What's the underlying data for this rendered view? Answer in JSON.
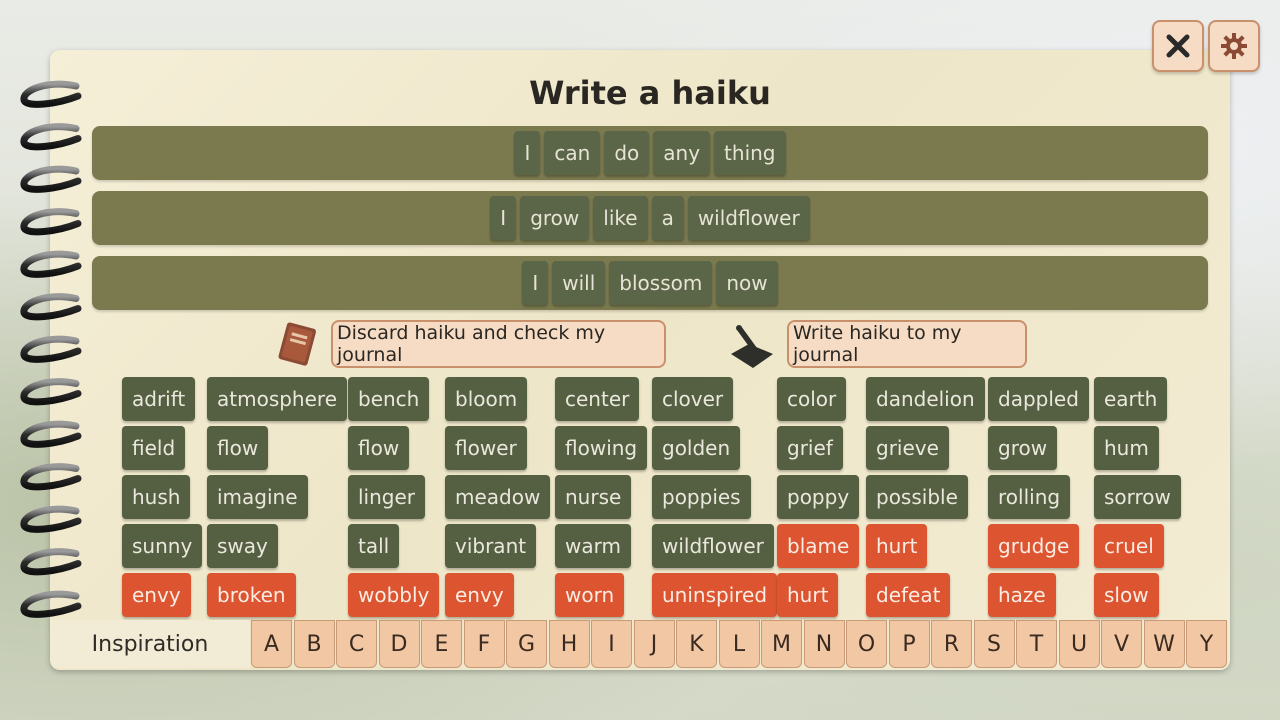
{
  "title": "Write a haiku",
  "haiku_lines": [
    [
      "I",
      "can",
      "do",
      "any",
      "thing"
    ],
    [
      "I",
      "grow",
      "like",
      "a",
      "wildflower"
    ],
    [
      "I",
      "will",
      "blossom",
      "now"
    ]
  ],
  "actions": {
    "discard_label": "Discard haiku and check my journal",
    "write_label": "Write haiku to my journal",
    "discard_icon": "journal-book-icon",
    "write_icon": "quill-pen-icon"
  },
  "word_grid": [
    [
      "adrift",
      "atmosphere",
      "bench",
      "bloom",
      "center",
      "clover",
      "color",
      "dandelion",
      "dappled",
      "earth"
    ],
    [
      "field",
      "flow",
      "flow",
      "flower",
      "flowing",
      "golden",
      "grief",
      "grieve",
      "grow",
      "hum"
    ],
    [
      "hush",
      "imagine",
      "linger",
      "meadow",
      "nurse",
      "poppies",
      "poppy",
      "possible",
      "rolling",
      "sorrow"
    ],
    [
      "sunny",
      "sway",
      "tall",
      "vibrant",
      "warm",
      "wildflower",
      "blame",
      "hurt",
      "grudge",
      "cruel"
    ],
    [
      "envy",
      "broken",
      "wobbly",
      "envy",
      "worn",
      "uninspired",
      "hurt",
      "defeat",
      "haze",
      "slow"
    ]
  ],
  "negative_words_row4_cols": [
    6,
    7,
    8,
    9
  ],
  "inspiration_label": "Inspiration",
  "letters": [
    "A",
    "B",
    "C",
    "D",
    "E",
    "F",
    "G",
    "H",
    "I",
    "J",
    "K",
    "L",
    "M",
    "N",
    "O",
    "P",
    "R",
    "S",
    "T",
    "U",
    "V",
    "W",
    "Y"
  ],
  "corner_buttons": {
    "close_icon": "close-icon",
    "settings_icon": "gear-icon"
  },
  "colors": {
    "positive_word": "#556043",
    "negative_word": "#dd5430",
    "line_bar": "#7b7a4f",
    "button_bg": "#f6dcc4",
    "tab_bg": "#f2c8a4"
  }
}
